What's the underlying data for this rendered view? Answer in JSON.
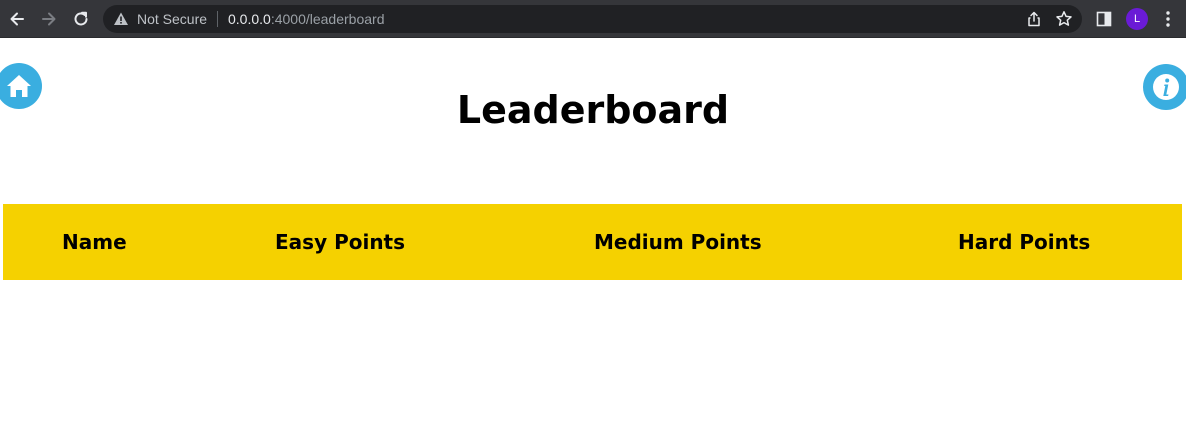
{
  "browser": {
    "security_label": "Not Secure",
    "url_host": "0.0.0.0",
    "url_path": ":4000/leaderboard",
    "profile_initial": "L"
  },
  "page": {
    "title": "Leaderboard"
  },
  "leaderboard": {
    "columns": [
      "Name",
      "Easy Points",
      "Medium Points",
      "Hard Points"
    ],
    "rows": []
  },
  "colors": {
    "browser_toolbar": "#35363a",
    "omnibox": "#202124",
    "accent_blue": "#3aaee0",
    "table_header": "#f5d100",
    "profile": "#6a1bd6"
  },
  "icons": {
    "home": "home-icon",
    "info": "info-icon"
  }
}
